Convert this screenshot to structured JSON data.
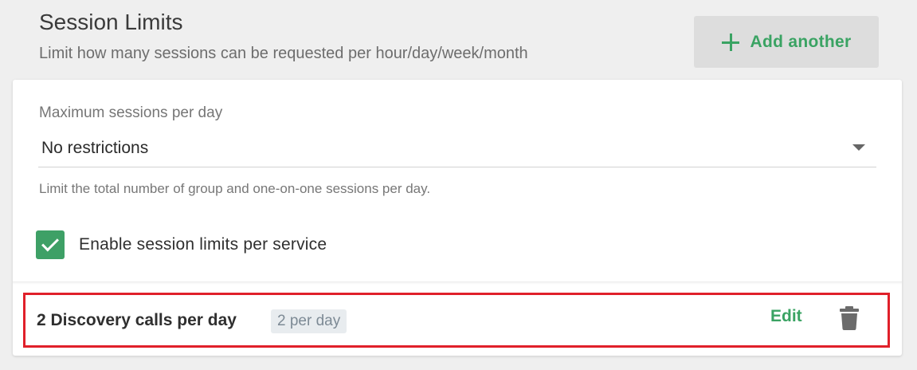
{
  "header": {
    "title": "Session Limits",
    "subtitle": "Limit how many sessions can be requested per hour/day/week/month",
    "add_button_label": "Add another"
  },
  "max_sessions": {
    "label": "Maximum sessions per day",
    "value": "No restrictions",
    "helper": "Limit the total number of group and one-on-one sessions per day."
  },
  "service_limits": {
    "checkbox_label": "Enable session limits per service",
    "checked": true,
    "items": [
      {
        "title": "2 Discovery calls per day",
        "badge": "2 per day",
        "edit_label": "Edit"
      }
    ]
  },
  "colors": {
    "accent": "#3aa363",
    "highlight": "#e0202a"
  },
  "icons": {
    "add": "plus-icon",
    "dropdown": "caret-down-icon",
    "checkbox": "check-icon",
    "delete": "trash-icon"
  }
}
